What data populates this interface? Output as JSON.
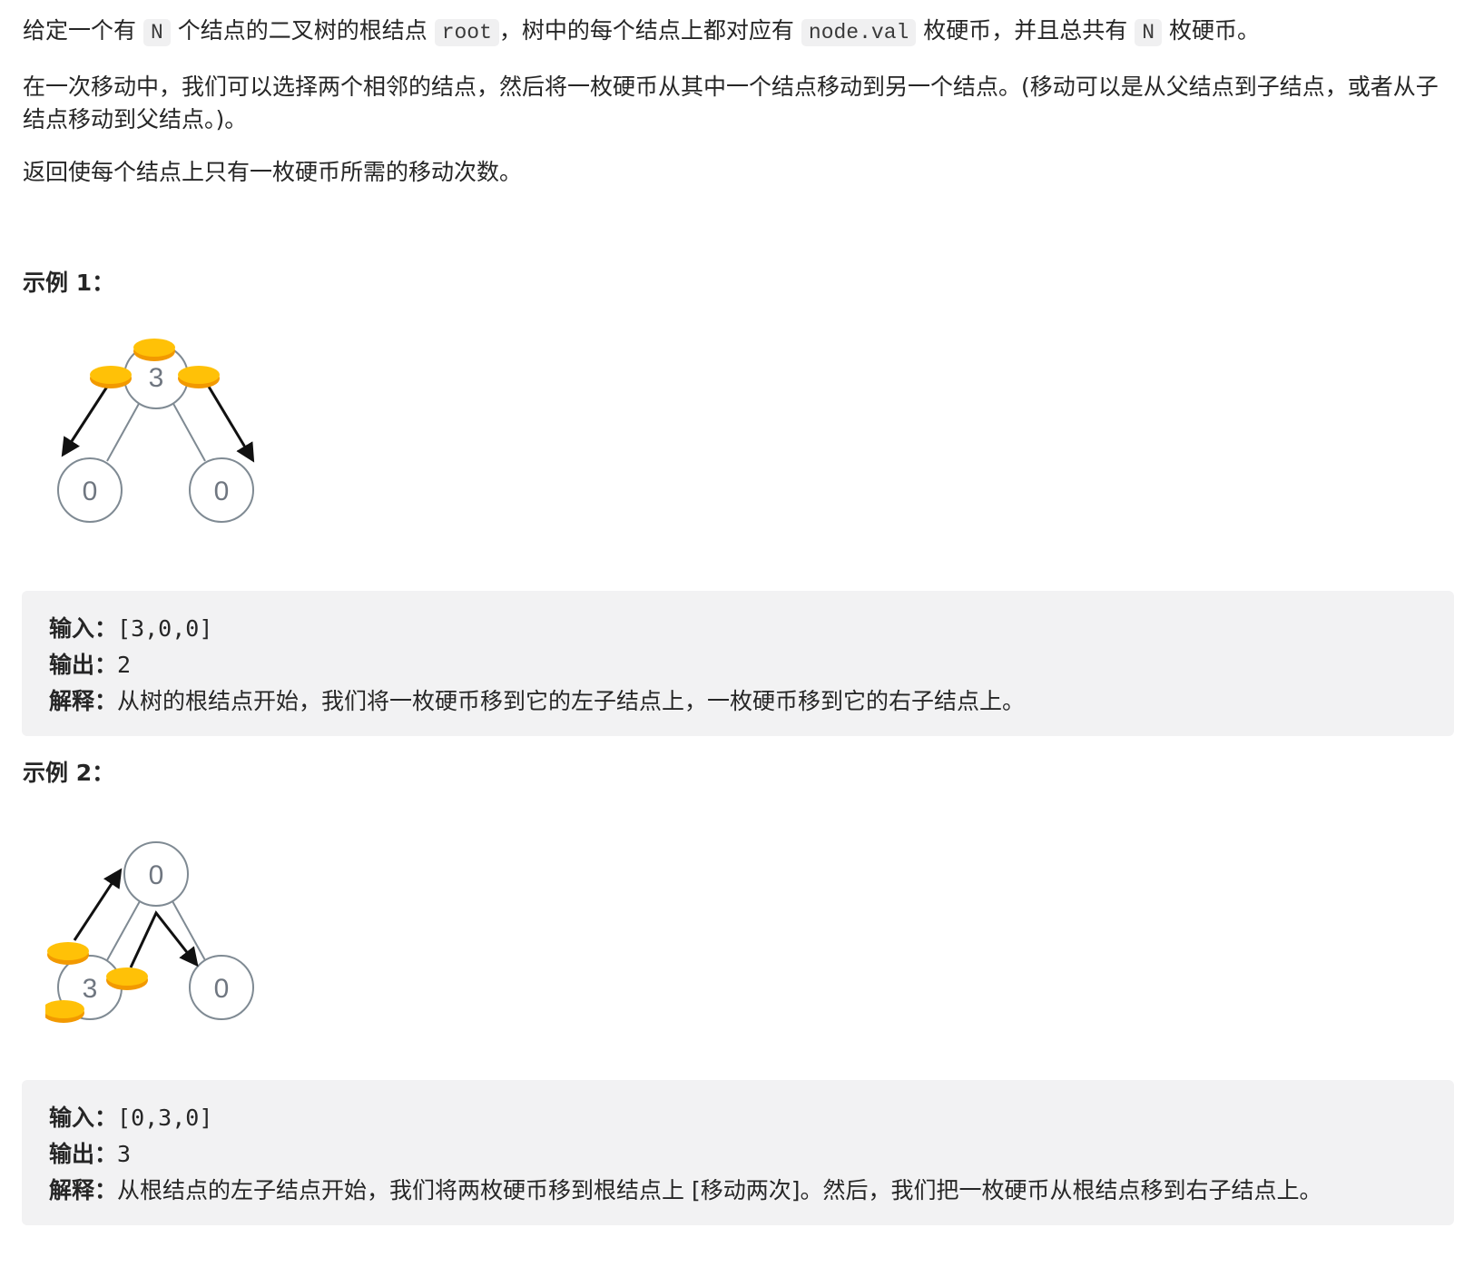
{
  "intro": {
    "p1": {
      "t1": "给定一个有",
      "c1": "N",
      "t2": "个结点的二叉树的根结点",
      "c2": "root",
      "t3": "，树中的每个结点上都对应有",
      "c3": "node.val",
      "t4": "枚硬币，并且总共有",
      "c4": "N",
      "t5": "枚硬币。"
    },
    "p2": "在一次移动中，我们可以选择两个相邻的结点，然后将一枚硬币从其中一个结点移动到另一个结点。(移动可以是从父结点到子结点，或者从子结点移动到父结点。)。",
    "p3": "返回使每个结点上只有一枚硬币所需的移动次数。"
  },
  "example1": {
    "heading": "示例 1：",
    "tree": {
      "root": "3",
      "left": "0",
      "right": "0"
    },
    "input_label": "输入：",
    "input_value": "[3,0,0]",
    "output_label": "输出：",
    "output_value": "2",
    "explain_label": "解释：",
    "explain_text": "从树的根结点开始，我们将一枚硬币移到它的左子结点上，一枚硬币移到它的右子结点上。"
  },
  "example2": {
    "heading": "示例 2：",
    "tree": {
      "root": "0",
      "left": "3",
      "right": "0"
    },
    "input_label": "输入：",
    "input_value": "[0,3,0]",
    "output_label": "输出：",
    "output_value": "3",
    "explain_label": "解释：",
    "explain_text": "从根结点的左子结点开始，我们将两枚硬币移到根结点上 [移动两次]。然后，我们把一枚硬币从根结点移到右子结点上。"
  },
  "colors": {
    "coin": "#ffc107",
    "coin_edge": "#f29900",
    "node_stroke": "#7f8a93",
    "arrow": "#111111",
    "code_bg": "#f2f2f3"
  }
}
